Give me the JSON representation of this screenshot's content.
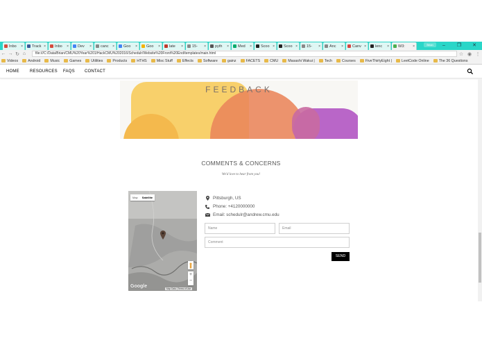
{
  "browser": {
    "tabs": [
      {
        "label": "Inbo",
        "color": "#d54b3d"
      },
      {
        "label": "Track",
        "color": "#3b5998"
      },
      {
        "label": "Inbo",
        "color": "#d54b3d"
      },
      {
        "label": "Dev",
        "color": "#4285f4"
      },
      {
        "label": "canc",
        "color": "#888888"
      },
      {
        "label": "Goo",
        "color": "#4285f4"
      },
      {
        "label": "Goo",
        "color": "#f4b400"
      },
      {
        "label": "late",
        "color": "#c0392b"
      },
      {
        "label": "15-",
        "color": "#888888"
      },
      {
        "label": "pyth",
        "color": "#555555"
      },
      {
        "label": "Med",
        "color": "#00ab6c"
      },
      {
        "label": "Scoo",
        "color": "#222222"
      },
      {
        "label": "Scoo",
        "color": "#222222"
      },
      {
        "label": "15-",
        "color": "#888888"
      },
      {
        "label": "Anc",
        "color": "#888888"
      },
      {
        "label": "Canv",
        "color": "#d64541"
      },
      {
        "label": "lenc",
        "color": "#222222"
      },
      {
        "label": "W3:",
        "color": "#4caf50",
        "active": true
      }
    ],
    "profile_label": "Brian",
    "url": "file:///C:/Data/Brian/CMU%20Year%201/HackCMU%202016/Schedulr/Website%20Front%20End/templates/main.html",
    "bookmarks": [
      "Videos",
      "Android",
      "Music",
      "Games",
      "Utilities",
      "Products",
      "HTHS",
      "Misc Stuff",
      "Effects",
      "Software",
      "gainz",
      "FACETS",
      "CMU",
      "Masashi Wakui |",
      "Tech",
      "Courses",
      "FiveThirtyEight |",
      "LeetCode Online",
      "The 36 Questions"
    ]
  },
  "nav": {
    "home": "HOME",
    "resources": "RESOURCES",
    "faqs": "FAQS",
    "contact": "CONTACT"
  },
  "banner": {
    "title": "FEEDBACK",
    "colors": [
      "#f8d06b",
      "#f4b94d",
      "#e9855a",
      "#c96aa1",
      "#b966c8"
    ]
  },
  "section": {
    "title": "COMMENTS & CONCERNS",
    "subtitle": "We'd love to hear from you!"
  },
  "map": {
    "tab_map": "Map",
    "tab_satellite": "Satellite",
    "logo": "Google",
    "footer": "Map Data | Terms of Use",
    "zoom_in": "+",
    "zoom_out": "−"
  },
  "contact": {
    "location": "Pittsburgh, US",
    "phone": "Phone: +4120000000",
    "email": "Email: schedulr@andrew.cmu.edu"
  },
  "form": {
    "name_placeholder": "Name",
    "email_placeholder": "Email",
    "comment_placeholder": "Comment",
    "send_label": "SEND"
  }
}
